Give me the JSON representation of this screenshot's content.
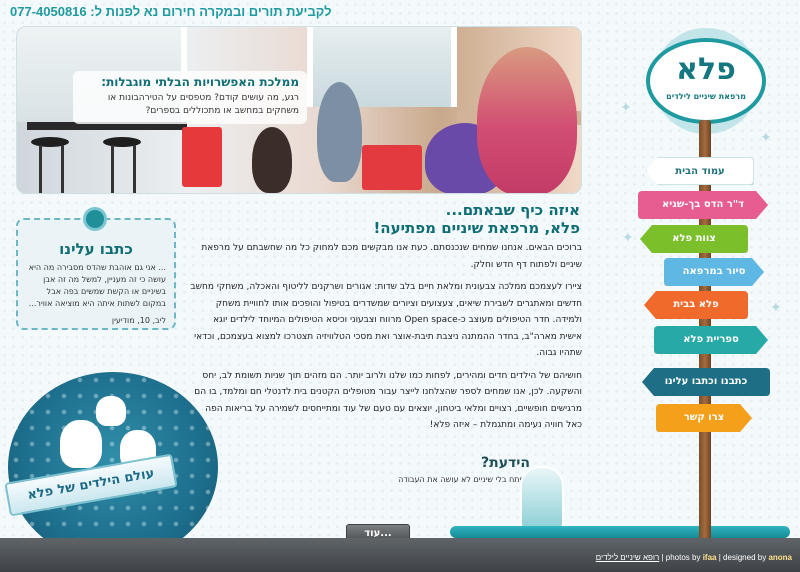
{
  "header": {
    "phone_text": "לקביעת תורים ובמקרה חירום נא לפנות ל: 077-4050816"
  },
  "hero": {
    "caption_title": "ממלכת האפשרויות הבלתי מוגבלות:",
    "caption_text": "רגע, מה עושים קודם? מטפסים על הטירהבונות או משחקים במחשב או מתכוללים בספרים?"
  },
  "main": {
    "heading_line1": "איזה כיף שבאתם...",
    "heading_line2": "פלא, מרפאת שיניים מפתיעה!",
    "paragraphs": [
      "ברוכים הבאים. אנחנו שמחים שנכנסתם. כעת אנו מבקשים מכם למחוק כל מה שחשבתם על מרפאת שיניים ולפתוח דף חדש וחלק.",
      "ציירו לעצמכם ממלכה צבעונית ומלאת חיים בלב שדות: אגורים ושרקנים לליטוף והאכלה, משחקי מחשב חדשים ומאתגרים לשבירת שיאים, צעצועים וציורים שמשדרים בטיפול והופכים אותו לחוויית משחק ולמידה. חדר הטיפולים מעוצב כ-Open space מרווח וצבעוני וכיסא הטיפולים המיוחד לילדים יוגא אישית מארה\"ב, בחדר ההמתנה ניצבת תיבת-אוצר ואת מסכי הטלוויזיה תצטרכו למצוא בעצמכם, וכדאי שתהיו גבוה.",
      "חושיהם של הילדים חדים ומהירים, לפחות כמו שלנו ולרוב יותר. הם מזהים תוך שניות תשומת לב, יחס והשקעה. לכן, אנו שמחים לספר שהצלחנו לייצר עבור מטופלים הקטנים בית לדנטלי חם ומלמד, בו הם מרגישים חופשיים, רצויים ומלאי ביטחון, יוצאים עם טעם של עוד ומתייחסים לשמירה על בריאות הפה כאל חוויה נעימה ומתגמלת – איזה פלא!"
    ]
  },
  "testimonial": {
    "title": "כתבו עלינו",
    "quote": "... אני גם אוהבת שהדס מסבירה מה היא עושה כי זה מעניין, למשל מה זה אבן בשיניים או הקשת שמשים בפה אבל במקום לשתות איתה היא מוציאה אוויר...",
    "signature": "ליב, 10, מודיעין"
  },
  "did_you_know": {
    "title": "הידעת?",
    "text": "מפתח בלי שיניים לא עושה את העבודה"
  },
  "more_button": "עוד...",
  "globe_banner": "עולם הילדים של פלא",
  "logo": {
    "name": "פלא",
    "tagline": "מרפאת שיניים לילדים"
  },
  "nav": [
    {
      "label": "עמוד הבית",
      "color": "#ffffff",
      "text_color": "#1f6f78"
    },
    {
      "label": "ד\"ר הדס בך-שגיא",
      "color": "#e75d92",
      "text_color": "#ffffff"
    },
    {
      "label": "צוות פלא",
      "color": "#7bbf2a",
      "text_color": "#ffffff"
    },
    {
      "label": "סיור במרפאה",
      "color": "#5fb7e3",
      "text_color": "#ffffff"
    },
    {
      "label": "פלא בבית",
      "color": "#f06a2c",
      "text_color": "#ffffff"
    },
    {
      "label": "ספריית פלא",
      "color": "#27a9a7",
      "text_color": "#ffffff"
    },
    {
      "label": "כתבנו וכתבו עלינו",
      "color": "#1e6f86",
      "text_color": "#ffffff"
    },
    {
      "label": "צרו קשר",
      "color": "#f4a01b",
      "text_color": "#ffffff"
    }
  ],
  "footer": {
    "site_link": "רופא שיניים לילדים",
    "photos_prefix": "photos by",
    "photos_by": "ifaa",
    "designed_prefix": "designed by",
    "designed_by": "anona"
  }
}
